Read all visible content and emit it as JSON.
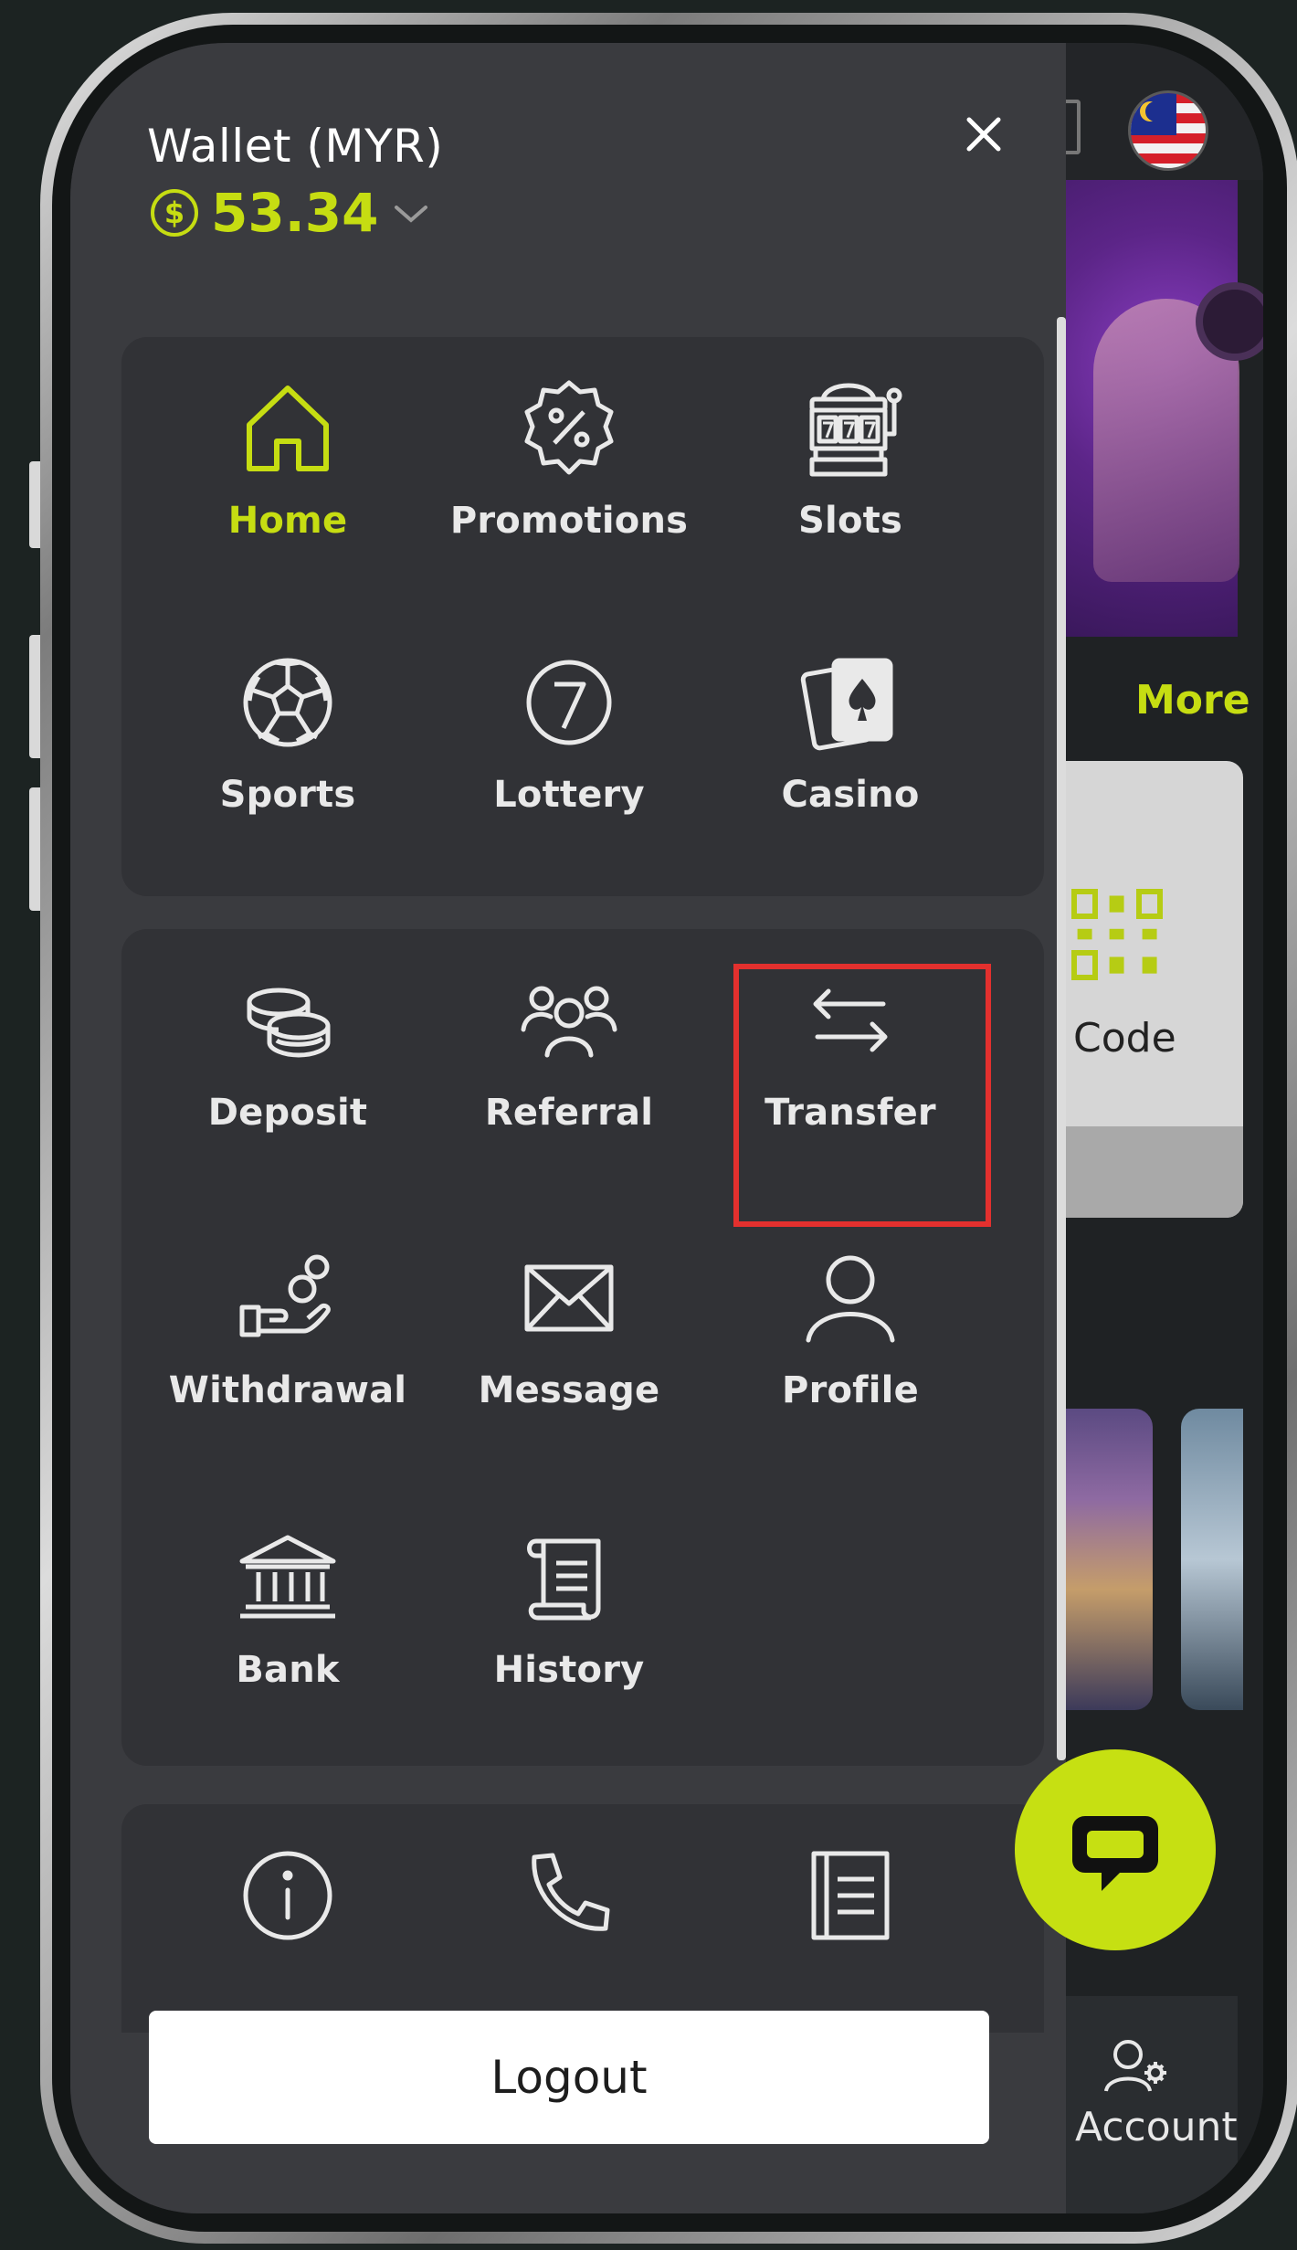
{
  "wallet": {
    "title": "Wallet (MYR)",
    "currency_icon": "dollar-coin-icon",
    "balance": "53.34"
  },
  "menu_primary": [
    {
      "label": "Home",
      "icon": "home-icon",
      "active": true
    },
    {
      "label": "Promotions",
      "icon": "percent-badge-icon",
      "active": false
    },
    {
      "label": "Slots",
      "icon": "slot-machine-icon",
      "active": false
    },
    {
      "label": "Sports",
      "icon": "soccer-ball-icon",
      "active": false
    },
    {
      "label": "Lottery",
      "icon": "lottery-ball-icon",
      "active": false
    },
    {
      "label": "Casino",
      "icon": "playing-cards-icon",
      "active": false
    }
  ],
  "menu_account": [
    {
      "label": "Deposit",
      "icon": "coins-icon"
    },
    {
      "label": "Referral",
      "icon": "users-icon"
    },
    {
      "label": "Transfer",
      "icon": "transfer-arrows-icon"
    },
    {
      "label": "Withdrawal",
      "icon": "hand-coins-icon"
    },
    {
      "label": "Message",
      "icon": "envelope-icon"
    },
    {
      "label": "Profile",
      "icon": "person-icon"
    },
    {
      "label": "Bank",
      "icon": "bank-icon"
    },
    {
      "label": "History",
      "icon": "scroll-icon"
    }
  ],
  "menu_info_icons": [
    "info-icon",
    "phone-icon",
    "document-icon"
  ],
  "logout_label": "Logout",
  "background": {
    "more_label": "More",
    "qr_label": "Code",
    "account_label": "Account"
  },
  "colors": {
    "accent": "#c6dd12",
    "drawer_bg": "#3a3b3f",
    "panel_bg": "#313236",
    "highlight": "#e3302e"
  }
}
